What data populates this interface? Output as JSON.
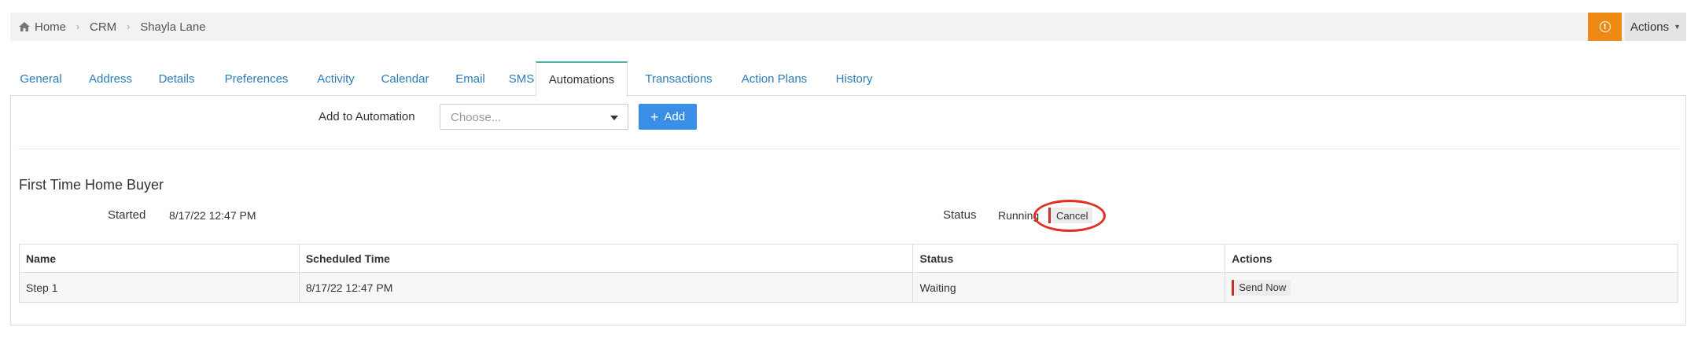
{
  "breadcrumb": [
    {
      "label": "Home",
      "icon": "home-icon"
    },
    {
      "label": "CRM"
    },
    {
      "label": "Shayla Lane"
    }
  ],
  "header": {
    "info_icon": "info-icon",
    "info_color": "#ee8a14",
    "actions_label": "Actions"
  },
  "tabs": [
    {
      "label": "General",
      "active": false
    },
    {
      "label": "Address",
      "active": false
    },
    {
      "label": "Details",
      "active": false
    },
    {
      "label": "Preferences",
      "active": false
    },
    {
      "label": "Activity",
      "active": false
    },
    {
      "label": "Calendar",
      "active": false
    },
    {
      "label": "Email",
      "active": false
    },
    {
      "label": "SMS",
      "active": false
    },
    {
      "label": "Automations",
      "active": true
    },
    {
      "label": "Transactions",
      "active": false
    },
    {
      "label": "Action Plans",
      "active": false
    },
    {
      "label": "History",
      "active": false
    }
  ],
  "add_automation": {
    "label": "Add to Automation",
    "select_placeholder": "Choose...",
    "add_button": "Add",
    "accent": "#3a8ee6"
  },
  "automation": {
    "title": "First Time Home Buyer",
    "started_label": "Started",
    "started_value": "8/17/22 12:47 PM",
    "status_label": "Status",
    "status_value": "Running",
    "cancel_label": "Cancel"
  },
  "steps_table": {
    "headers": [
      "Name",
      "Scheduled Time",
      "Status",
      "Actions"
    ],
    "rows": [
      {
        "name": "Step 1",
        "scheduled_time": "8/17/22 12:47 PM",
        "status": "Waiting",
        "action": "Send Now"
      }
    ]
  }
}
